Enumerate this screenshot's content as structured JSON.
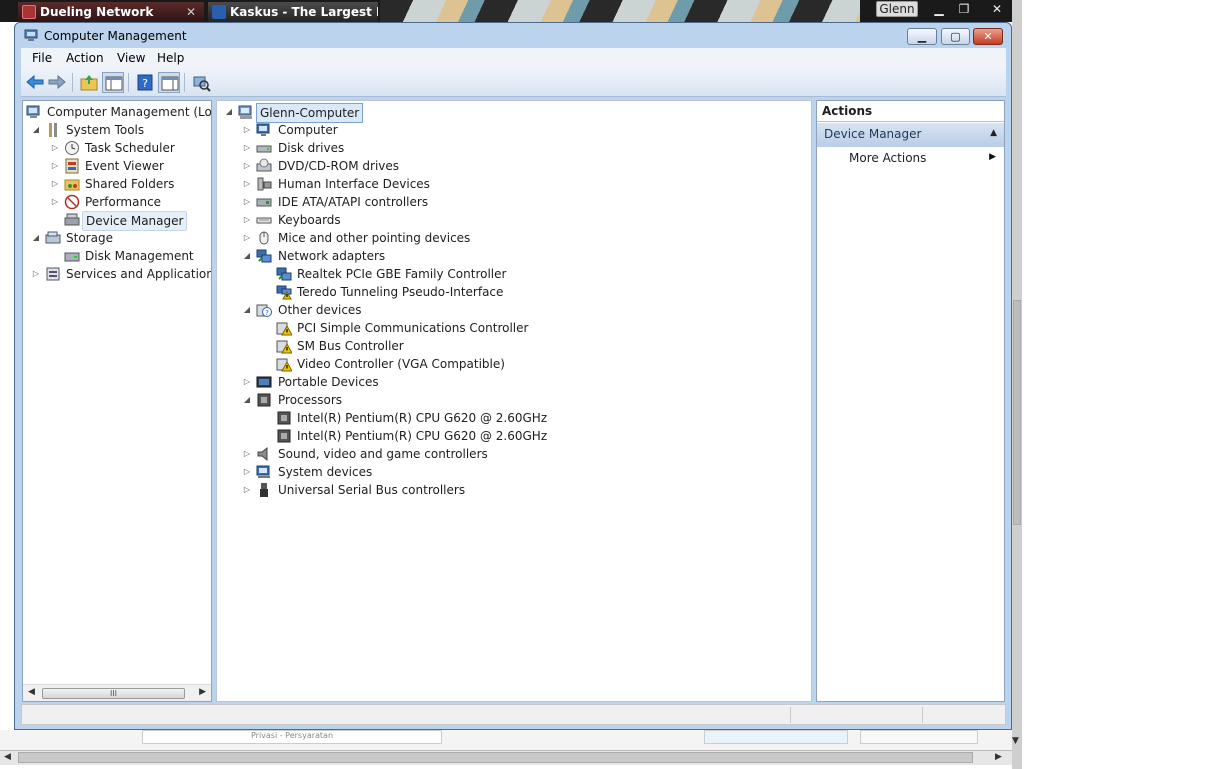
{
  "background": {
    "tabs": [
      {
        "title": "Dueling Network"
      },
      {
        "title": "Kaskus - The Largest Indo"
      }
    ],
    "user_label": "Glenn",
    "footer_text": "Privasi - Persyaratan"
  },
  "window": {
    "title": "Computer Management",
    "menu": [
      "File",
      "Action",
      "View",
      "Help"
    ],
    "toolbar": [
      "back-arrow-icon",
      "forward-arrow-icon",
      "up-folder-icon",
      "show-hide-tree-icon",
      "help-icon",
      "show-hide-action-icon",
      "scan-hardware-icon"
    ]
  },
  "nav_tree": {
    "items": [
      {
        "label": "Computer Management (Local",
        "icon": "computer-management-icon"
      },
      {
        "label": "System Tools",
        "icon": "tools-icon"
      },
      {
        "label": "Task Scheduler",
        "icon": "clock-icon"
      },
      {
        "label": "Event Viewer",
        "icon": "event-viewer-icon"
      },
      {
        "label": "Shared Folders",
        "icon": "shared-folder-icon"
      },
      {
        "label": "Performance",
        "icon": "performance-icon"
      },
      {
        "label": "Device Manager",
        "icon": "device-manager-icon"
      },
      {
        "label": "Storage",
        "icon": "storage-icon"
      },
      {
        "label": "Disk Management",
        "icon": "disk-icon"
      },
      {
        "label": "Services and Applications",
        "icon": "services-icon"
      }
    ],
    "scroll_thumb": "III"
  },
  "device_tree": {
    "root": "Glenn-Computer",
    "items": [
      {
        "label": "Computer",
        "icon": "monitor-icon"
      },
      {
        "label": "Disk drives",
        "icon": "disk-drive-icon"
      },
      {
        "label": "DVD/CD-ROM drives",
        "icon": "dvd-drive-icon"
      },
      {
        "label": "Human Interface Devices",
        "icon": "hid-icon"
      },
      {
        "label": "IDE ATA/ATAPI controllers",
        "icon": "ide-controller-icon"
      },
      {
        "label": "Keyboards",
        "icon": "keyboard-icon"
      },
      {
        "label": "Mice and other pointing devices",
        "icon": "mouse-icon"
      },
      {
        "label": "Network adapters",
        "icon": "network-adapter-icon"
      },
      {
        "label": "Realtek PCIe GBE Family Controller",
        "icon": "network-adapter-icon"
      },
      {
        "label": "Teredo Tunneling Pseudo-Interface",
        "icon": "network-adapter-warning-icon"
      },
      {
        "label": "Other devices",
        "icon": "unknown-device-icon"
      },
      {
        "label": "PCI Simple Communications Controller",
        "icon": "unknown-device-warning-icon"
      },
      {
        "label": "SM Bus Controller",
        "icon": "unknown-device-warning-icon"
      },
      {
        "label": "Video Controller (VGA Compatible)",
        "icon": "unknown-device-warning-icon"
      },
      {
        "label": "Portable Devices",
        "icon": "portable-device-icon"
      },
      {
        "label": "Processors",
        "icon": "processor-icon"
      },
      {
        "label": "Intel(R) Pentium(R) CPU G620 @ 2.60GHz",
        "icon": "processor-icon"
      },
      {
        "label": "Intel(R) Pentium(R) CPU G620 @ 2.60GHz",
        "icon": "processor-icon"
      },
      {
        "label": "Sound, video and game controllers",
        "icon": "speaker-icon"
      },
      {
        "label": "System devices",
        "icon": "system-device-icon"
      },
      {
        "label": "Universal Serial Bus controllers",
        "icon": "usb-icon"
      }
    ]
  },
  "actions": {
    "header": "Actions",
    "section": "Device Manager",
    "items": [
      "More Actions"
    ]
  },
  "colors": {
    "window_frame": "#bcd3ee",
    "selection": "#dbe8f7",
    "warning": "#f2c400"
  }
}
